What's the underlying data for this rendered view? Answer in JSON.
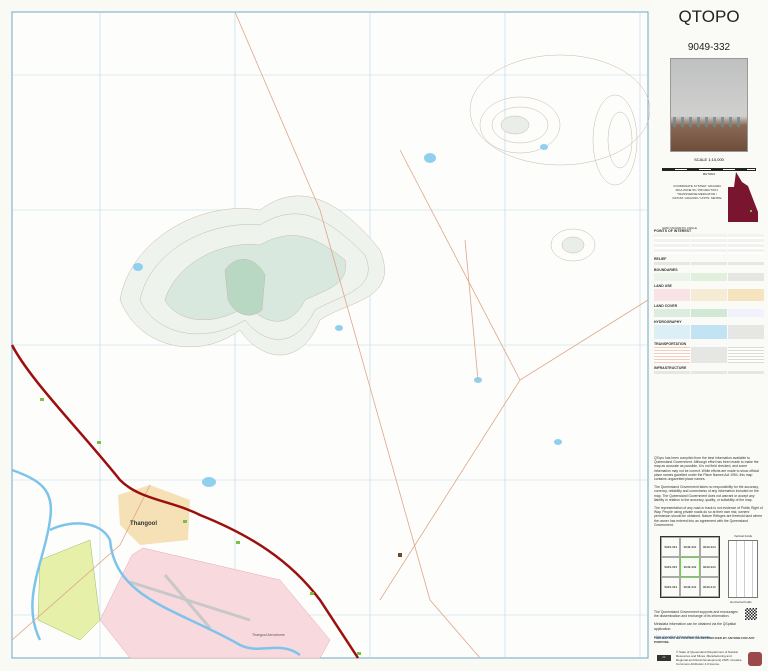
{
  "header": {
    "product": "QTOPO",
    "sheet_number": "9049-332"
  },
  "scale": {
    "label": "SCALE 1:10,000",
    "ticks": [
      "0",
      "100",
      "200",
      "400",
      "600",
      "800"
    ],
    "unit": "METRES"
  },
  "projection_note": "COORDINATE SYSTEM: GDA2020 MGA ZONE 56 / PROJECTION: TRANSVERSE MERCATOR / DATUM: GDA2020 / UNITS: METRE",
  "north_note": "GRID MAGNETIC ANGLE",
  "legend": {
    "sections": [
      "POINTS OF INTEREST",
      "RELIEF",
      "BOUNDARIES",
      "LAND USE",
      "LAND COVER",
      "HYDROGRAPHY",
      "TRANSPORTATION",
      "INFRASTRUCTURE"
    ]
  },
  "map": {
    "town_label": "Thangool",
    "aerodrome_label": "Thangool Aerodrome",
    "colors": {
      "highway": "#9c0f0f",
      "water": "#8fd0ef",
      "aerodrome": "#f8d9de",
      "urban": "#f4d9a6",
      "vegetation": "#cfe6d4"
    }
  },
  "disclaimers": [
    "QTopo has been compiled from the best information available to Queensland Government. Although effort has been made to make the map as accurate as possible, it is not field checked, and some information may not be correct. While efforts are made to show official place names gazetted under the Place Names Act 1994, this map contains ungazetted place names.",
    "The Queensland Government takes no responsibility for the accuracy, currency, reliability and correctness of any information included on the map. The Queensland Government does not warrant or accept any liability in relation to the accuracy, quality, or suitability of the map.",
    "The representation of any road or track is not evidence of Public Right of Way. People using private roads do so at their own risk; owners' permission should be obtained. Nature Refuges are freehold land where the owner has entered into an agreement with the Queensland Government."
  ],
  "index_sheets": [
    "9049-334",
    "9049-331",
    "9049-324",
    "9049-333",
    "9049-332",
    "9049-323",
    "9049-343",
    "9049-341",
    "9049-413"
  ],
  "folding_labels": [
    "Vertical Folds",
    "Horizontal Folds"
  ],
  "exchange_note": "The Queensland Government supports and encourages the dissemination and exchange of its information.",
  "metadata_note": "Metadata information can be obtained via the QSpatial application:",
  "metadata_link": "https://qspatial.information.qld.gov.au",
  "print_note": "THIS MAP MAY BE PRINTED OR REPRODUCED BY ANYONE FOR ANY PURPOSE.",
  "copyright": "© State of Queensland (Department of Natural Resources and Mines, Manufacturing and Regional and Rural Development) 2025. Creative Commons Attribution 4.0 licence."
}
